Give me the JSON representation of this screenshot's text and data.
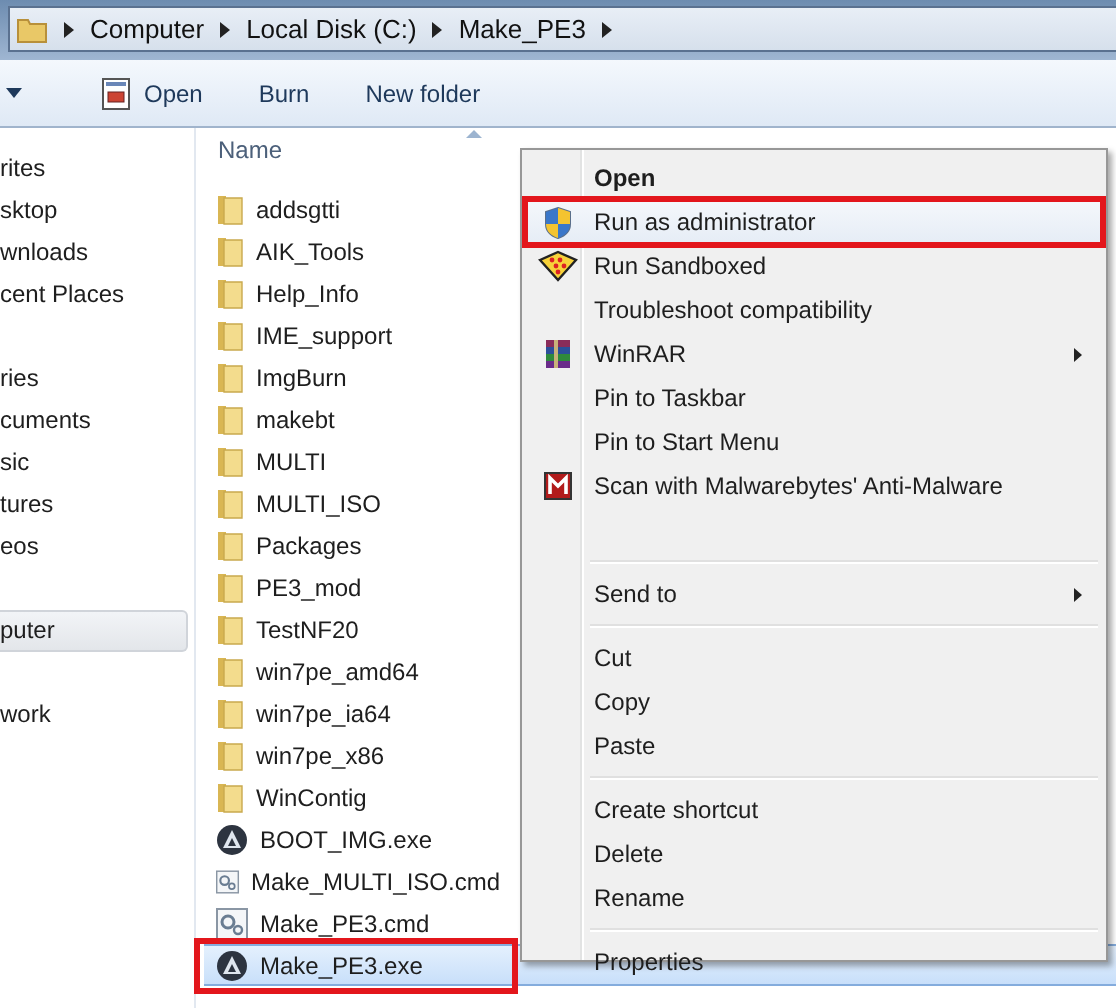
{
  "address_bar": {
    "crumbs": [
      "Computer",
      "Local Disk (C:)",
      "Make_PE3"
    ]
  },
  "toolbar": {
    "buttons": [
      {
        "label": "Open",
        "kind": "open"
      },
      {
        "label": "Burn",
        "kind": "plain"
      },
      {
        "label": "New folder",
        "kind": "plain"
      }
    ]
  },
  "sidebar": {
    "groups": [
      {
        "items": [
          {
            "label": "rites",
            "selected": false
          },
          {
            "label": "sktop",
            "selected": false
          },
          {
            "label": "wnloads",
            "selected": false
          },
          {
            "label": "cent Places",
            "selected": false
          }
        ]
      },
      {
        "items": [
          {
            "label": "ries",
            "selected": false
          },
          {
            "label": "cuments",
            "selected": false
          },
          {
            "label": "sic",
            "selected": false
          },
          {
            "label": "tures",
            "selected": false
          },
          {
            "label": "eos",
            "selected": false
          }
        ]
      },
      {
        "items": [
          {
            "label": "puter",
            "selected": true
          }
        ]
      },
      {
        "items": [
          {
            "label": "work",
            "selected": false
          }
        ]
      }
    ]
  },
  "file_list": {
    "columns": [
      "Name"
    ],
    "rows": [
      {
        "name": "addsgtti",
        "kind": "folder",
        "selected": false,
        "outlined": false
      },
      {
        "name": "AIK_Tools",
        "kind": "folder",
        "selected": false,
        "outlined": false
      },
      {
        "name": "Help_Info",
        "kind": "folder",
        "selected": false,
        "outlined": false
      },
      {
        "name": "IME_support",
        "kind": "folder",
        "selected": false,
        "outlined": false
      },
      {
        "name": "ImgBurn",
        "kind": "folder",
        "selected": false,
        "outlined": false
      },
      {
        "name": "makebt",
        "kind": "folder",
        "selected": false,
        "outlined": false
      },
      {
        "name": "MULTI",
        "kind": "folder",
        "selected": false,
        "outlined": false
      },
      {
        "name": "MULTI_ISO",
        "kind": "folder",
        "selected": false,
        "outlined": false
      },
      {
        "name": "Packages",
        "kind": "folder",
        "selected": false,
        "outlined": false
      },
      {
        "name": "PE3_mod",
        "kind": "folder",
        "selected": false,
        "outlined": false
      },
      {
        "name": "TestNF20",
        "kind": "folder",
        "selected": false,
        "outlined": false
      },
      {
        "name": "win7pe_amd64",
        "kind": "folder",
        "selected": false,
        "outlined": false
      },
      {
        "name": "win7pe_ia64",
        "kind": "folder",
        "selected": false,
        "outlined": false
      },
      {
        "name": "win7pe_x86",
        "kind": "folder",
        "selected": false,
        "outlined": false
      },
      {
        "name": "WinContig",
        "kind": "folder",
        "selected": false,
        "outlined": false
      },
      {
        "name": "BOOT_IMG.exe",
        "kind": "exe",
        "selected": false,
        "outlined": false
      },
      {
        "name": "Make_MULTI_ISO.cmd",
        "kind": "cmd",
        "selected": false,
        "outlined": false
      },
      {
        "name": "Make_PE3.cmd",
        "kind": "cmd",
        "selected": false,
        "outlined": false
      },
      {
        "name": "Make_PE3.exe",
        "kind": "exe",
        "selected": true,
        "outlined": true
      }
    ]
  },
  "context_menu": {
    "items": [
      {
        "kind": "item",
        "label": "Open",
        "bold": true,
        "submenu": false,
        "selected": false,
        "outlined": false
      },
      {
        "kind": "item",
        "label": "Run as administrator",
        "bold": false,
        "submenu": false,
        "selected": true,
        "outlined": true
      },
      {
        "kind": "item",
        "label": "Run Sandboxed",
        "bold": false,
        "submenu": false,
        "selected": false,
        "outlined": false
      },
      {
        "kind": "item",
        "label": "Troubleshoot compatibility",
        "bold": false,
        "submenu": false,
        "selected": false,
        "outlined": false
      },
      {
        "kind": "item",
        "label": "WinRAR",
        "bold": false,
        "submenu": true,
        "selected": false,
        "outlined": false
      },
      {
        "kind": "item",
        "label": "Pin to Taskbar",
        "bold": false,
        "submenu": false,
        "selected": false,
        "outlined": false
      },
      {
        "kind": "item",
        "label": "Pin to Start Menu",
        "bold": false,
        "submenu": false,
        "selected": false,
        "outlined": false
      },
      {
        "kind": "item",
        "label": "Scan with Malwarebytes' Anti-Malware",
        "bold": false,
        "submenu": false,
        "selected": false,
        "outlined": false
      },
      {
        "kind": "separator"
      },
      {
        "kind": "item",
        "label": "Send to",
        "bold": false,
        "submenu": true,
        "selected": false,
        "outlined": false
      },
      {
        "kind": "separator"
      },
      {
        "kind": "item",
        "label": "Cut",
        "bold": false,
        "submenu": false,
        "selected": false,
        "outlined": false
      },
      {
        "kind": "item",
        "label": "Copy",
        "bold": false,
        "submenu": false,
        "selected": false,
        "outlined": false
      },
      {
        "kind": "item",
        "label": "Paste",
        "bold": false,
        "submenu": false,
        "selected": false,
        "outlined": false
      },
      {
        "kind": "separator"
      },
      {
        "kind": "item",
        "label": "Create shortcut",
        "bold": false,
        "submenu": false,
        "selected": false,
        "outlined": false
      },
      {
        "kind": "item",
        "label": "Delete",
        "bold": false,
        "submenu": false,
        "selected": false,
        "outlined": false
      },
      {
        "kind": "item",
        "label": "Rename",
        "bold": false,
        "submenu": false,
        "selected": false,
        "outlined": false
      },
      {
        "kind": "separator"
      },
      {
        "kind": "item",
        "label": "Properties",
        "bold": false,
        "submenu": false,
        "selected": false,
        "outlined": false
      }
    ]
  }
}
